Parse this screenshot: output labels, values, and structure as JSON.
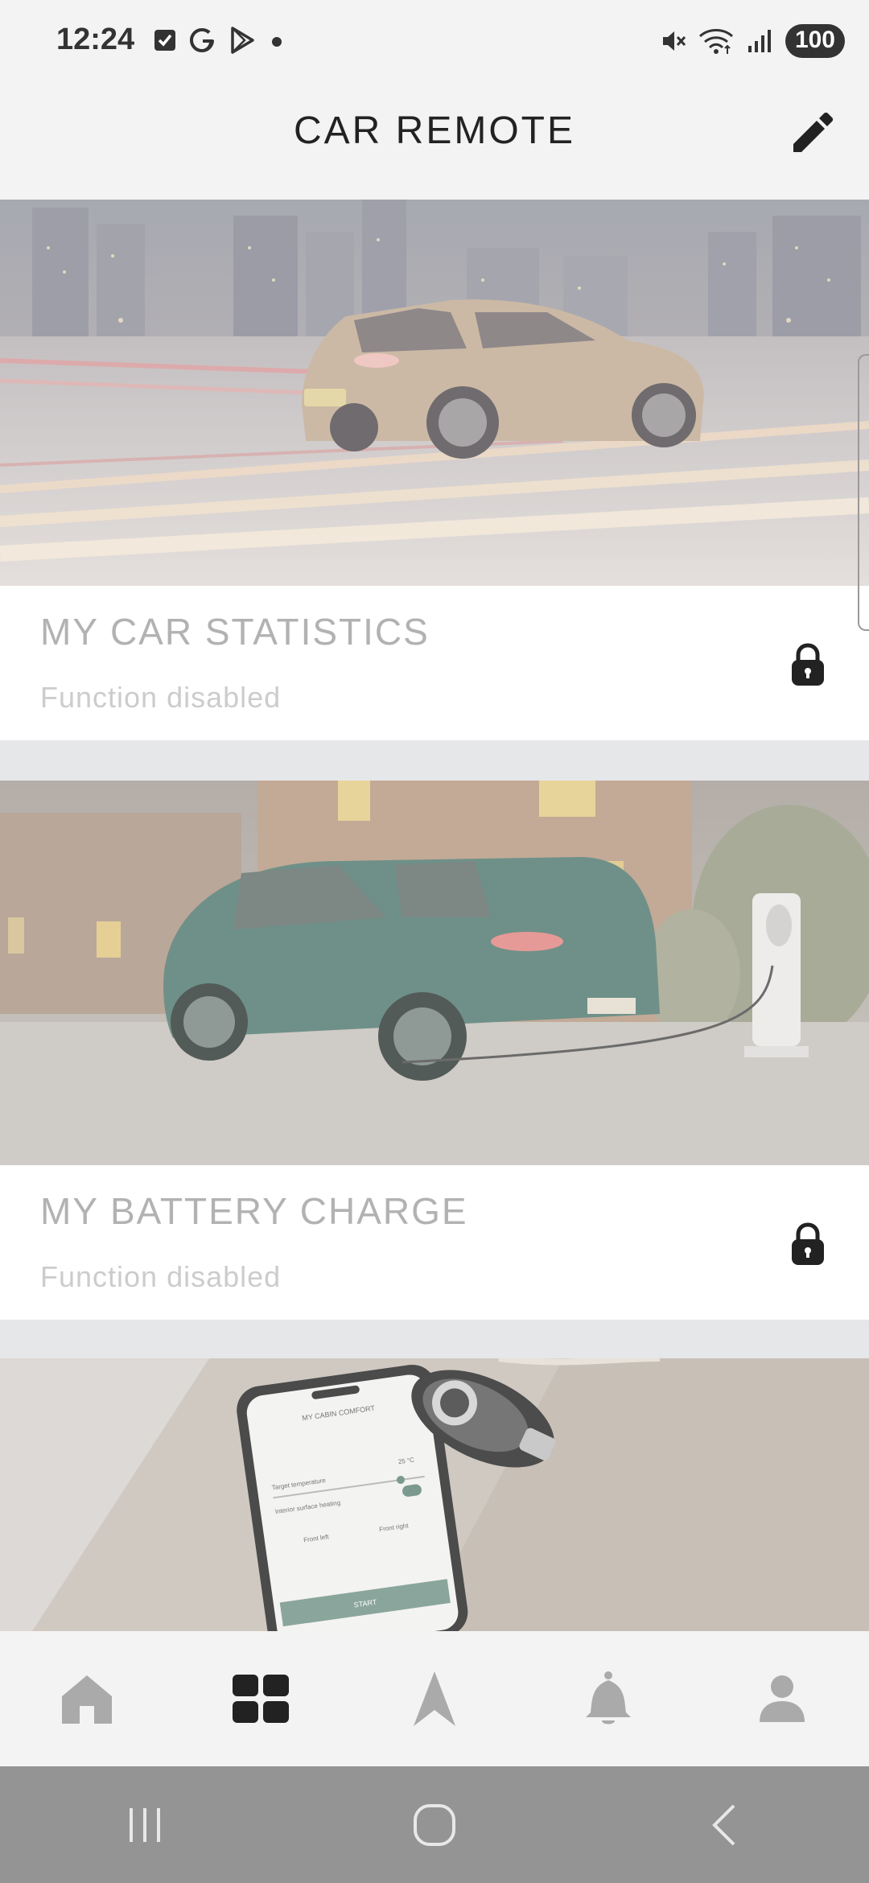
{
  "status_bar": {
    "time": "12:24",
    "battery": "100",
    "left_icons": [
      "check-square-icon",
      "google-icon",
      "play-icon",
      "dot-icon"
    ],
    "right_icons": [
      "mute-icon",
      "wifi-icon",
      "signal-icon"
    ]
  },
  "header": {
    "title": "CAR REMOTE",
    "edit_icon": "pencil-icon"
  },
  "cards": [
    {
      "title": "MY CAR STATISTICS",
      "subtitle": "Function disabled",
      "locked": true,
      "image": "city-night-car-image"
    },
    {
      "title": "MY BATTERY CHARGE",
      "subtitle": "Function disabled",
      "locked": true,
      "image": "charging-car-image"
    },
    {
      "title": "",
      "subtitle": "",
      "locked": false,
      "image": "phone-and-key-image",
      "phone_screen": {
        "header": "MY CABIN COMFORT",
        "target_label": "Target temperature",
        "target_value": "25 °C",
        "heating_label": "Interior surface heating",
        "front_left": "Front left",
        "front_right": "Front right",
        "start_label": "START"
      }
    }
  ],
  "bottom_nav": [
    {
      "name": "home",
      "icon": "home-icon",
      "active": false
    },
    {
      "name": "dashboard",
      "icon": "grid-icon",
      "active": true
    },
    {
      "name": "navigation",
      "icon": "navigation-arrow-icon",
      "active": false
    },
    {
      "name": "notifications",
      "icon": "bell-icon",
      "active": false
    },
    {
      "name": "profile",
      "icon": "person-icon",
      "active": false
    }
  ],
  "system_nav": [
    "recents-icon",
    "home-circle-icon",
    "back-icon"
  ],
  "colors": {
    "background": "#f3f3f3",
    "gap_band": "#e6e7e9",
    "title_disabled": "#b2b2b2",
    "subtitle_disabled": "#cccccc",
    "nav_active": "#222222",
    "nav_inactive": "#aaaaaa",
    "system_nav_bg": "#949494"
  }
}
